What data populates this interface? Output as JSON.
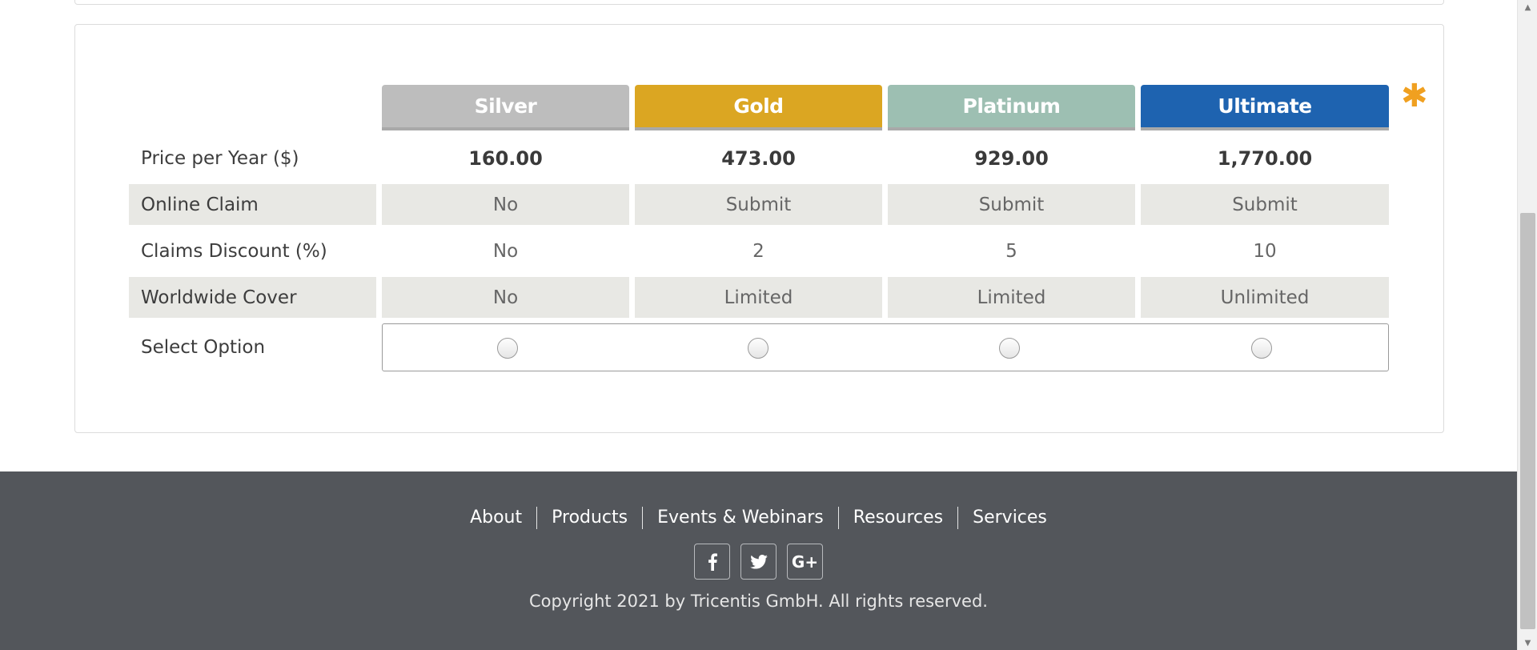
{
  "tiers": [
    {
      "name": "Silver",
      "color": "#bdbdbd"
    },
    {
      "name": "Gold",
      "color": "#dba622"
    },
    {
      "name": "Platinum",
      "color": "#9dbfb2"
    },
    {
      "name": "Ultimate",
      "color": "#1e63b0"
    }
  ],
  "rows": {
    "price": {
      "label": "Price per Year ($)",
      "values": [
        "160.00",
        "473.00",
        "929.00",
        "1,770.00"
      ]
    },
    "online_claim": {
      "label": "Online Claim",
      "values": [
        "No",
        "Submit",
        "Submit",
        "Submit"
      ]
    },
    "claims_discount": {
      "label": "Claims Discount (%)",
      "values": [
        "No",
        "2",
        "5",
        "10"
      ]
    },
    "worldwide_cover": {
      "label": "Worldwide Cover",
      "values": [
        "No",
        "Limited",
        "Limited",
        "Unlimited"
      ]
    },
    "select_option": {
      "label": "Select Option"
    }
  },
  "star": "✱",
  "footer": {
    "links": [
      "About",
      "Products",
      "Events & Webinars",
      "Resources",
      "Services"
    ],
    "socials": [
      {
        "icon": "facebook-icon",
        "glyph": "f"
      },
      {
        "icon": "twitter-icon",
        "glyph": "t"
      },
      {
        "icon": "google-plus-icon",
        "glyph": "G+"
      }
    ],
    "copyright": "Copyright 2021 by Tricentis GmbH. All rights reserved."
  }
}
